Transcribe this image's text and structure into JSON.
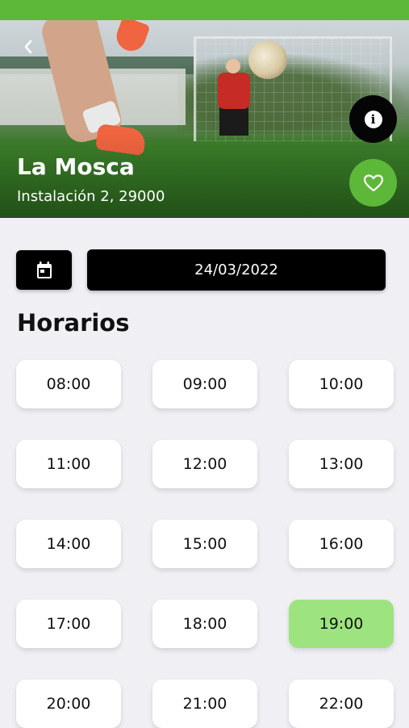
{
  "venue": {
    "name": "La Mosca",
    "address": "Instalación 2, 29000"
  },
  "date": {
    "value": "24/03/2022"
  },
  "schedule": {
    "title": "Horarios",
    "slots": [
      {
        "time": "08:00",
        "selected": false
      },
      {
        "time": "09:00",
        "selected": false
      },
      {
        "time": "10:00",
        "selected": false
      },
      {
        "time": "11:00",
        "selected": false
      },
      {
        "time": "12:00",
        "selected": false
      },
      {
        "time": "13:00",
        "selected": false
      },
      {
        "time": "14:00",
        "selected": false
      },
      {
        "time": "15:00",
        "selected": false
      },
      {
        "time": "16:00",
        "selected": false
      },
      {
        "time": "17:00",
        "selected": false
      },
      {
        "time": "18:00",
        "selected": false
      },
      {
        "time": "19:00",
        "selected": true
      },
      {
        "time": "20:00",
        "selected": false
      },
      {
        "time": "21:00",
        "selected": false
      },
      {
        "time": "22:00",
        "selected": false
      }
    ]
  },
  "icons": {
    "back": "chevron-left-icon",
    "info": "info-icon",
    "favorite": "heart-outline-icon",
    "calendar": "calendar-icon"
  },
  "colors": {
    "accent": "#5db83a",
    "selected_slot": "#9de37f",
    "dark": "#000000",
    "background": "#f0eff4"
  }
}
